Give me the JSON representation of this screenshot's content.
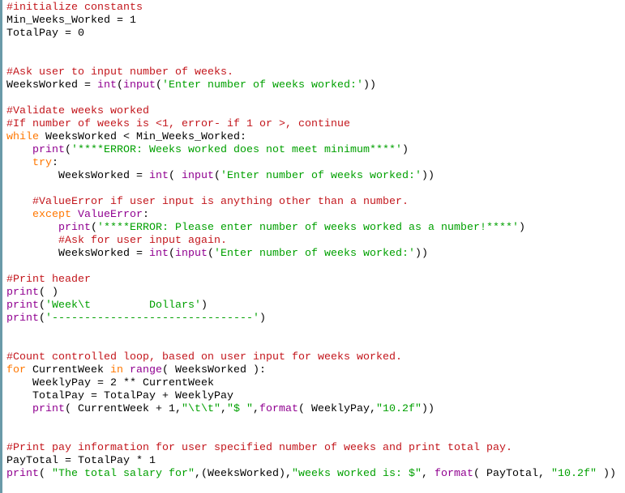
{
  "editor": {
    "language": "python",
    "colors": {
      "comment": "#c3161c",
      "keyword": "#ff7700",
      "builtin": "#900090",
      "string": "#00a000",
      "plain": "#000000",
      "background": "#ffffff",
      "gutter_border": "#6a9aa8"
    },
    "lines": [
      [
        [
          "comment",
          "#initialize constants"
        ]
      ],
      [
        [
          "plain",
          "Min_Weeks_Worked = 1"
        ]
      ],
      [
        [
          "plain",
          "TotalPay = 0"
        ]
      ],
      [],
      [],
      [
        [
          "comment",
          "#Ask user to input number of weeks."
        ]
      ],
      [
        [
          "plain",
          "WeeksWorked = "
        ],
        [
          "builtin",
          "int"
        ],
        [
          "plain",
          "("
        ],
        [
          "builtin",
          "input"
        ],
        [
          "plain",
          "("
        ],
        [
          "string",
          "'Enter number of weeks worked:'"
        ],
        [
          "plain",
          "))"
        ]
      ],
      [],
      [
        [
          "comment",
          "#Validate weeks worked"
        ]
      ],
      [
        [
          "comment",
          "#If number of weeks is <1, error- if 1 or >, continue"
        ]
      ],
      [
        [
          "keyword",
          "while"
        ],
        [
          "plain",
          " WeeksWorked < Min_Weeks_Worked:"
        ]
      ],
      [
        [
          "plain",
          "    "
        ],
        [
          "builtin",
          "print"
        ],
        [
          "plain",
          "("
        ],
        [
          "string",
          "'****ERROR: Weeks worked does not meet minimum****'"
        ],
        [
          "plain",
          ")"
        ]
      ],
      [
        [
          "plain",
          "    "
        ],
        [
          "keyword",
          "try"
        ],
        [
          "plain",
          ":"
        ]
      ],
      [
        [
          "plain",
          "        WeeksWorked = "
        ],
        [
          "builtin",
          "int"
        ],
        [
          "plain",
          "( "
        ],
        [
          "builtin",
          "input"
        ],
        [
          "plain",
          "("
        ],
        [
          "string",
          "'Enter number of weeks worked:'"
        ],
        [
          "plain",
          "))"
        ]
      ],
      [],
      [
        [
          "plain",
          "    "
        ],
        [
          "comment",
          "#ValueError if user input is anything other than a number."
        ]
      ],
      [
        [
          "plain",
          "    "
        ],
        [
          "keyword",
          "except"
        ],
        [
          "plain",
          " "
        ],
        [
          "builtin",
          "ValueError"
        ],
        [
          "plain",
          ":"
        ]
      ],
      [
        [
          "plain",
          "        "
        ],
        [
          "builtin",
          "print"
        ],
        [
          "plain",
          "("
        ],
        [
          "string",
          "'****ERROR: Please enter number of weeks worked as a number!****'"
        ],
        [
          "plain",
          ")"
        ]
      ],
      [
        [
          "plain",
          "        "
        ],
        [
          "comment",
          "#Ask for user input again."
        ]
      ],
      [
        [
          "plain",
          "        WeeksWorked = "
        ],
        [
          "builtin",
          "int"
        ],
        [
          "plain",
          "("
        ],
        [
          "builtin",
          "input"
        ],
        [
          "plain",
          "("
        ],
        [
          "string",
          "'Enter number of weeks worked:'"
        ],
        [
          "plain",
          "))"
        ]
      ],
      [],
      [
        [
          "comment",
          "#Print header"
        ]
      ],
      [
        [
          "builtin",
          "print"
        ],
        [
          "plain",
          "( )"
        ]
      ],
      [
        [
          "builtin",
          "print"
        ],
        [
          "plain",
          "("
        ],
        [
          "string",
          "'Week\\t         Dollars'"
        ],
        [
          "plain",
          ")"
        ]
      ],
      [
        [
          "builtin",
          "print"
        ],
        [
          "plain",
          "("
        ],
        [
          "string",
          "'-------------------------------'"
        ],
        [
          "plain",
          ")"
        ]
      ],
      [],
      [],
      [
        [
          "comment",
          "#Count controlled loop, based on user input for weeks worked."
        ]
      ],
      [
        [
          "keyword",
          "for"
        ],
        [
          "plain",
          " CurrentWeek "
        ],
        [
          "keyword",
          "in"
        ],
        [
          "plain",
          " "
        ],
        [
          "builtin",
          "range"
        ],
        [
          "plain",
          "( WeeksWorked ):"
        ]
      ],
      [
        [
          "plain",
          "    WeeklyPay = 2 ** CurrentWeek"
        ]
      ],
      [
        [
          "plain",
          "    TotalPay = TotalPay + WeeklyPay"
        ]
      ],
      [
        [
          "plain",
          "    "
        ],
        [
          "builtin",
          "print"
        ],
        [
          "plain",
          "( CurrentWeek + 1,"
        ],
        [
          "string",
          "\"\\t\\t\""
        ],
        [
          "plain",
          ","
        ],
        [
          "string",
          "\"$ \""
        ],
        [
          "plain",
          ","
        ],
        [
          "builtin",
          "format"
        ],
        [
          "plain",
          "( WeeklyPay,"
        ],
        [
          "string",
          "\"10.2f\""
        ],
        [
          "plain",
          "))"
        ]
      ],
      [],
      [],
      [
        [
          "comment",
          "#Print pay information for user specified number of weeks and print total pay."
        ]
      ],
      [
        [
          "plain",
          "PayTotal = TotalPay * 1"
        ]
      ],
      [
        [
          "builtin",
          "print"
        ],
        [
          "plain",
          "( "
        ],
        [
          "string",
          "\"The total salary for\""
        ],
        [
          "plain",
          ",(WeeksWorked),"
        ],
        [
          "string",
          "\"weeks worked is: $\""
        ],
        [
          "plain",
          ", "
        ],
        [
          "builtin",
          "format"
        ],
        [
          "plain",
          "( PayTotal, "
        ],
        [
          "string",
          "\"10.2f\""
        ],
        [
          "plain",
          " ))"
        ]
      ]
    ]
  }
}
